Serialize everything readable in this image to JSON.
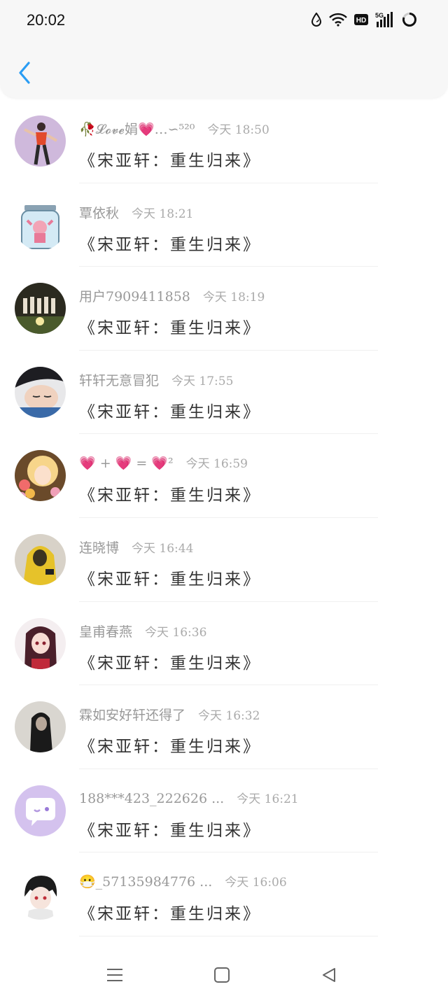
{
  "status_bar": {
    "time": "20:02",
    "icons": [
      "drop-icon",
      "wifi-icon",
      "hd-badge-icon",
      "5g-signal-icon",
      "battery-ring-icon"
    ],
    "hd_label": "HD",
    "net_label": "5G"
  },
  "header": {
    "back_icon": "chevron-left-icon",
    "accent_color": "#2a9df4"
  },
  "messages": [
    {
      "name": "🥀𝓛𝓸𝓿𝓮娟💗…∽⁵²⁰",
      "time": "今天 18:50",
      "text": "《宋亚轩：重生归来》",
      "avatar": "dancer-red-avatar"
    },
    {
      "name": "覃依秋",
      "time": "今天 18:21",
      "text": "《宋亚轩：重生归来》",
      "avatar": "jar-girl-avatar"
    },
    {
      "name": "用户7909411858",
      "time": "今天 18:19",
      "text": "《宋亚轩：重生归来》",
      "avatar": "group-photo-avatar"
    },
    {
      "name": "轩轩无意冒犯",
      "time": "今天 17:55",
      "text": "《宋亚轩：重生归来》",
      "avatar": "sleeping-boy-avatar"
    },
    {
      "name": "💗 + 💗 = 💗²",
      "time": "今天 16:59",
      "text": "《宋亚轩：重生归来》",
      "avatar": "anime-girl-flowers-avatar"
    },
    {
      "name": "连晓博",
      "time": "今天 16:44",
      "text": "《宋亚轩：重生归来》",
      "avatar": "yellow-hoodie-avatar"
    },
    {
      "name": "皇甫春燕",
      "time": "今天 16:36",
      "text": "《宋亚轩：重生归来》",
      "avatar": "anime-dark-hair-avatar"
    },
    {
      "name": "霖如安好轩还得了",
      "time": "今天 16:32",
      "text": "《宋亚轩：重生归来》",
      "avatar": "dark-portrait-avatar"
    },
    {
      "name": "188***423_222626 ...",
      "time": "今天 16:21",
      "text": "《宋亚轩：重生归来》",
      "avatar": "default-chat-avatar"
    },
    {
      "name": "😷_57135984776 ...",
      "time": "今天 16:06",
      "text": "《宋亚轩：重生归来》",
      "avatar": "anime-boy-avatar"
    }
  ],
  "nav": {
    "icons": [
      "menu-icon",
      "home-square-icon",
      "back-triangle-icon"
    ]
  }
}
